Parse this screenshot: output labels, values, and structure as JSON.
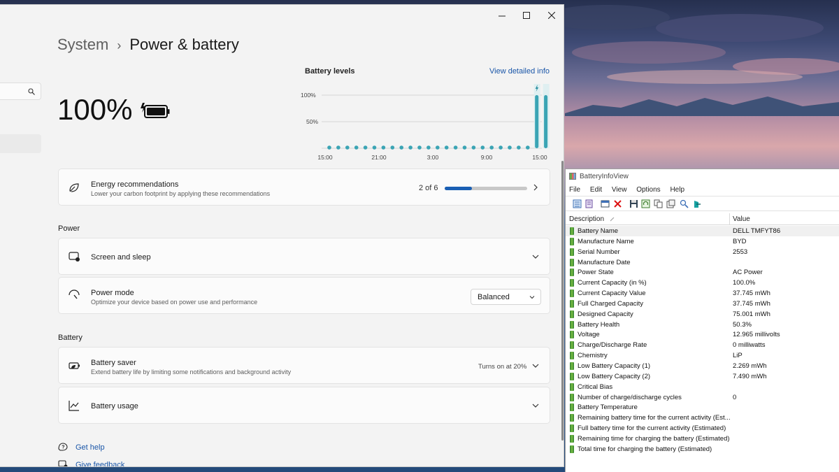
{
  "settings": {
    "breadcrumb_parent": "System",
    "breadcrumb_sep": "›",
    "page_title": "Power & battery",
    "battery_percent": "100%",
    "battery_levels": {
      "title": "Battery levels",
      "link": "View detailed info",
      "y_ticks": [
        "100%",
        "50%"
      ],
      "x_ticks": [
        "15:00",
        "21:00",
        "3:00",
        "9:00",
        "15:00"
      ]
    },
    "energy": {
      "title": "Energy recommendations",
      "subtitle": "Lower your carbon footprint by applying these recommendations",
      "progress_text": "2 of 6",
      "progress_fraction": 0.33
    },
    "power_header": "Power",
    "screen_sleep": {
      "title": "Screen and sleep"
    },
    "power_mode": {
      "title": "Power mode",
      "subtitle": "Optimize your device based on power use and performance",
      "selected": "Balanced"
    },
    "battery_header": "Battery",
    "battery_saver": {
      "title": "Battery saver",
      "subtitle": "Extend battery life by limiting some notifications and background activity",
      "status": "Turns on at 20%"
    },
    "battery_usage": {
      "title": "Battery usage"
    },
    "get_help": "Get help",
    "give_feedback": "Give feedback"
  },
  "chart_data": {
    "type": "bar",
    "title": "Battery levels",
    "ylim": [
      0,
      100
    ],
    "yticks": [
      "100%",
      "50%"
    ],
    "categories": [
      "15:00",
      "21:00",
      "3:00",
      "9:00",
      "15:00"
    ],
    "values": [
      0,
      0,
      0,
      0,
      0,
      0,
      0,
      0,
      0,
      0,
      0,
      0,
      0,
      0,
      0,
      0,
      0,
      0,
      0,
      0,
      0,
      0,
      0,
      100,
      100
    ],
    "charging_indicator": "lightning-bolt"
  },
  "biv": {
    "title": "BatteryInfoView",
    "menu": [
      "File",
      "Edit",
      "View",
      "Options",
      "Help"
    ],
    "col_description": "Description",
    "col_value": "Value",
    "rows": [
      {
        "d": "Battery Name",
        "v": "DELL TMFYT86"
      },
      {
        "d": "Manufacture Name",
        "v": "BYD"
      },
      {
        "d": "Serial Number",
        "v": "2553"
      },
      {
        "d": "Manufacture Date",
        "v": ""
      },
      {
        "d": "Power State",
        "v": "AC Power"
      },
      {
        "d": "Current Capacity (in %)",
        "v": "100.0%"
      },
      {
        "d": "Current Capacity Value",
        "v": "37.745 mWh"
      },
      {
        "d": "Full Charged Capacity",
        "v": "37.745 mWh"
      },
      {
        "d": "Designed Capacity",
        "v": "75.001 mWh"
      },
      {
        "d": "Battery Health",
        "v": "50.3%"
      },
      {
        "d": "Voltage",
        "v": "12.965 millivolts"
      },
      {
        "d": "Charge/Discharge Rate",
        "v": "0 milliwatts"
      },
      {
        "d": "Chemistry",
        "v": "LiP"
      },
      {
        "d": "Low Battery Capacity (1)",
        "v": "2.269 mWh"
      },
      {
        "d": "Low Battery Capacity (2)",
        "v": "7.490 mWh"
      },
      {
        "d": "Critical Bias",
        "v": ""
      },
      {
        "d": "Number of charge/discharge cycles",
        "v": "0"
      },
      {
        "d": "Battery Temperature",
        "v": ""
      },
      {
        "d": "Remaining battery time for the current activity (Est...",
        "v": ""
      },
      {
        "d": "Full battery time for the current activity (Estimated)",
        "v": ""
      },
      {
        "d": "Remaining time for charging the battery (Estimated)",
        "v": ""
      },
      {
        "d": "Total  time for charging the battery (Estimated)",
        "v": ""
      }
    ]
  }
}
